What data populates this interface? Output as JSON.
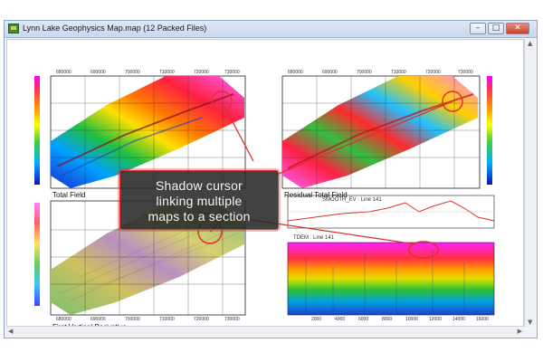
{
  "window": {
    "title": "Lynn Lake Geophysics Map.map (12 Packed Files)",
    "minimize_symbol": "–",
    "maximize_symbol": "□",
    "close_symbol": "✕"
  },
  "maps": {
    "total_field": {
      "title": "Total Field",
      "x_ticks": [
        "680000",
        "690000",
        "700000",
        "710000",
        "720000",
        "730000"
      ]
    },
    "residual": {
      "title": "Residual Total Field",
      "x_ticks": [
        "680000",
        "690000",
        "700000",
        "710000",
        "720000",
        "730000"
      ]
    },
    "derivative": {
      "title": "First Vertical Derivative",
      "x_ticks": [
        "680000",
        "690000",
        "700000",
        "710000",
        "720000",
        "730000"
      ]
    }
  },
  "section": {
    "profile_label": "SMOOTH_EV : Line 141",
    "tdem_label": "TDEM : Line 141",
    "x_ticks": [
      "2000",
      "4000",
      "6000",
      "8000",
      "10000",
      "12000",
      "14000",
      "16000"
    ]
  },
  "callout": {
    "line1": "Shadow cursor",
    "line2": "linking multiple",
    "line3": "maps to a section"
  },
  "colors": {
    "highlight": "#e03030",
    "window_border": "#8fa6c4"
  }
}
